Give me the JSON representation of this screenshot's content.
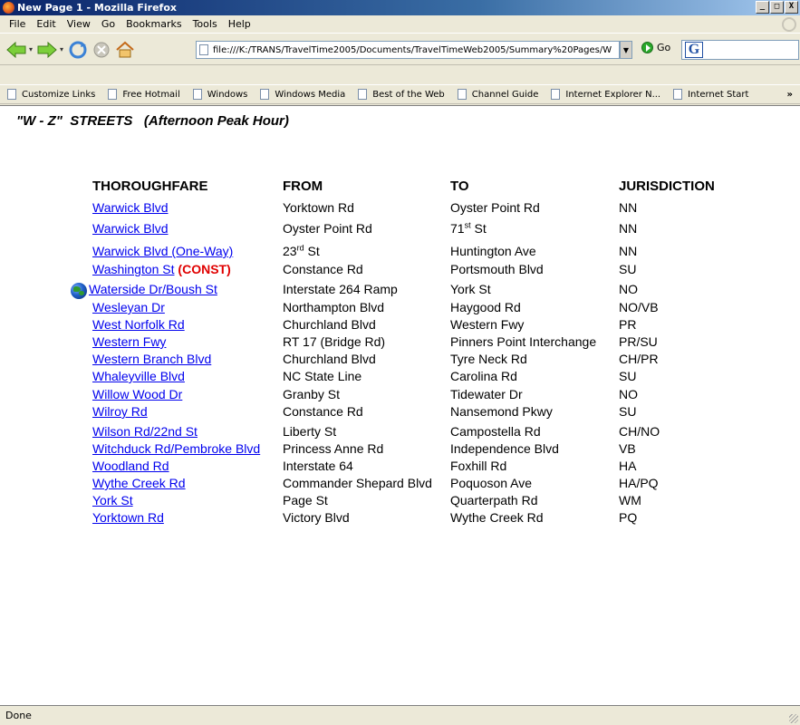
{
  "window": {
    "title": "New Page 1 - Mozilla Firefox",
    "minimize": "_",
    "maximize": "□",
    "close": "X"
  },
  "menu": [
    "File",
    "Edit",
    "View",
    "Go",
    "Bookmarks",
    "Tools",
    "Help"
  ],
  "toolbar": {
    "url": "file:///K:/TRANS/TravelTime2005/Documents/TravelTimeWeb2005/Summary%20Pages/W",
    "go_label": "Go"
  },
  "bookmarks": [
    "Customize Links",
    "Free Hotmail",
    "Windows",
    "Windows Media",
    "Best of the Web",
    "Channel Guide",
    "Internet Explorer N...",
    "Internet Start"
  ],
  "bookmarks_more": "»",
  "page": {
    "heading": "\"W - Z\"  STREETS   (Afternoon Peak Hour)",
    "columns": {
      "thoroughfare": "THOROUGHFARE",
      "from": "FROM",
      "to": "TO",
      "jurisdiction": "JURISDICTION"
    },
    "const_tag": "(CONST)",
    "rows": [
      {
        "street": "Warwick Blvd",
        "from": "Yorktown Rd",
        "to": "Oyster Point Rd",
        "jur": "NN"
      },
      {
        "street": "Warwick Blvd",
        "from": "Oyster Point Rd",
        "to_base": "71",
        "to_sup": "st",
        "to_rest": " St",
        "jur": "NN"
      },
      {
        "street": "Warwick Blvd (One-Way)",
        "from_base": "23",
        "from_sup": "rd",
        "from_rest": " St",
        "to": "Huntington Ave",
        "jur": "NN"
      },
      {
        "street": "Washington St",
        "from": "Constance Rd",
        "to": "Portsmouth Blvd",
        "jur": "SU"
      },
      {
        "street": "Waterside Dr/Boush St",
        "from": "Interstate 264 Ramp",
        "to": "York St",
        "jur": "NO"
      },
      {
        "street": "Wesleyan Dr",
        "from": "Northampton Blvd",
        "to": "Haygood Rd",
        "jur": "NO/VB"
      },
      {
        "street": "West Norfolk Rd",
        "from": "Churchland Blvd",
        "to": "Western Fwy",
        "jur": "PR"
      },
      {
        "street": "Western Fwy",
        "from": "RT 17 (Bridge Rd)",
        "to": "Pinners Point Interchange",
        "jur": "PR/SU"
      },
      {
        "street": "Western Branch Blvd",
        "from": "Churchland Blvd",
        "to": "Tyre Neck Rd",
        "jur": "CH/PR"
      },
      {
        "street": "Whaleyville Blvd",
        "from": "NC State Line",
        "to": "Carolina Rd",
        "jur": "SU"
      },
      {
        "street": "Willow Wood Dr",
        "from": "Granby St",
        "to": "Tidewater Dr",
        "jur": "NO"
      },
      {
        "street": "Wilroy Rd",
        "from": "Constance Rd",
        "to": "Nansemond Pkwy",
        "jur": "SU"
      },
      {
        "street": "Wilson Rd/22nd St",
        "from": "Liberty St",
        "to": "Campostella Rd",
        "jur": "CH/NO"
      },
      {
        "street": "Witchduck Rd/Pembroke Blvd",
        "from": "Princess Anne Rd",
        "to": "Independence Blvd",
        "jur": "VB"
      },
      {
        "street": "Woodland Rd",
        "from": "Interstate 64",
        "to": "Foxhill Rd",
        "jur": "HA"
      },
      {
        "street": "Wythe Creek Rd",
        "from": "Commander Shepard Blvd",
        "to": "Poquoson Ave",
        "jur": "HA/PQ"
      },
      {
        "street": "York St",
        "from": "Page St",
        "to": "Quarterpath Rd",
        "jur": "WM"
      },
      {
        "street": "Yorktown Rd",
        "from": "Victory Blvd",
        "to": "Wythe Creek Rd",
        "jur": "PQ"
      }
    ]
  },
  "status": "Done"
}
